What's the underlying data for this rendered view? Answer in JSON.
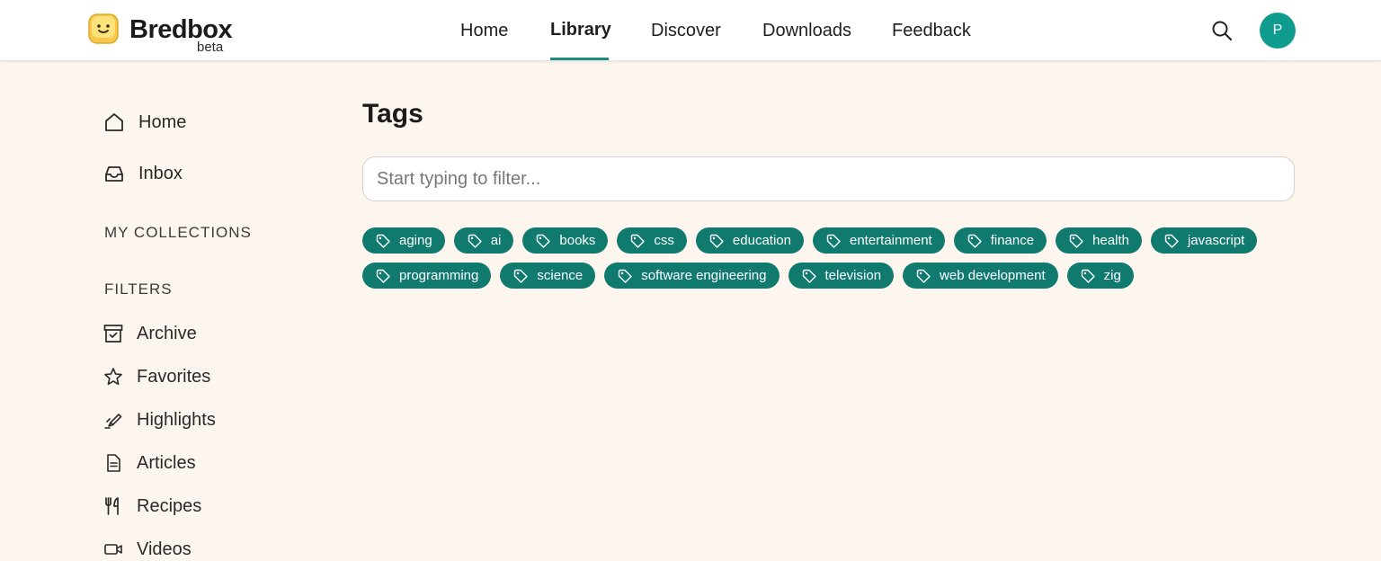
{
  "app": {
    "name": "Bredbox",
    "badge": "beta"
  },
  "nav": {
    "items": [
      "Home",
      "Library",
      "Discover",
      "Downloads",
      "Feedback"
    ],
    "active": "Library"
  },
  "header": {
    "search_icon": "search-icon",
    "avatar_initial": "P",
    "avatar_color": "#0f9b8e"
  },
  "sidebar": {
    "top_items": [
      {
        "label": "Home",
        "icon": "house-icon"
      },
      {
        "label": "Inbox",
        "icon": "inbox-icon"
      }
    ],
    "collections_heading": "MY COLLECTIONS",
    "filters_heading": "FILTERS",
    "filters": [
      {
        "label": "Archive",
        "icon": "archive-icon"
      },
      {
        "label": "Favorites",
        "icon": "star-icon"
      },
      {
        "label": "Highlights",
        "icon": "highlighter-icon"
      },
      {
        "label": "Articles",
        "icon": "document-icon"
      },
      {
        "label": "Recipes",
        "icon": "utensils-icon"
      },
      {
        "label": "Videos",
        "icon": "video-icon"
      }
    ]
  },
  "main": {
    "title": "Tags",
    "filter_placeholder": "Start typing to filter...",
    "tags": [
      "aging",
      "ai",
      "books",
      "css",
      "education",
      "entertainment",
      "finance",
      "health",
      "javascript",
      "programming",
      "science",
      "software engineering",
      "television",
      "web development",
      "zig"
    ]
  },
  "colors": {
    "accent": "#1f8a80",
    "tag_bg": "#117a6f",
    "page_bg": "#fdf6ef"
  }
}
